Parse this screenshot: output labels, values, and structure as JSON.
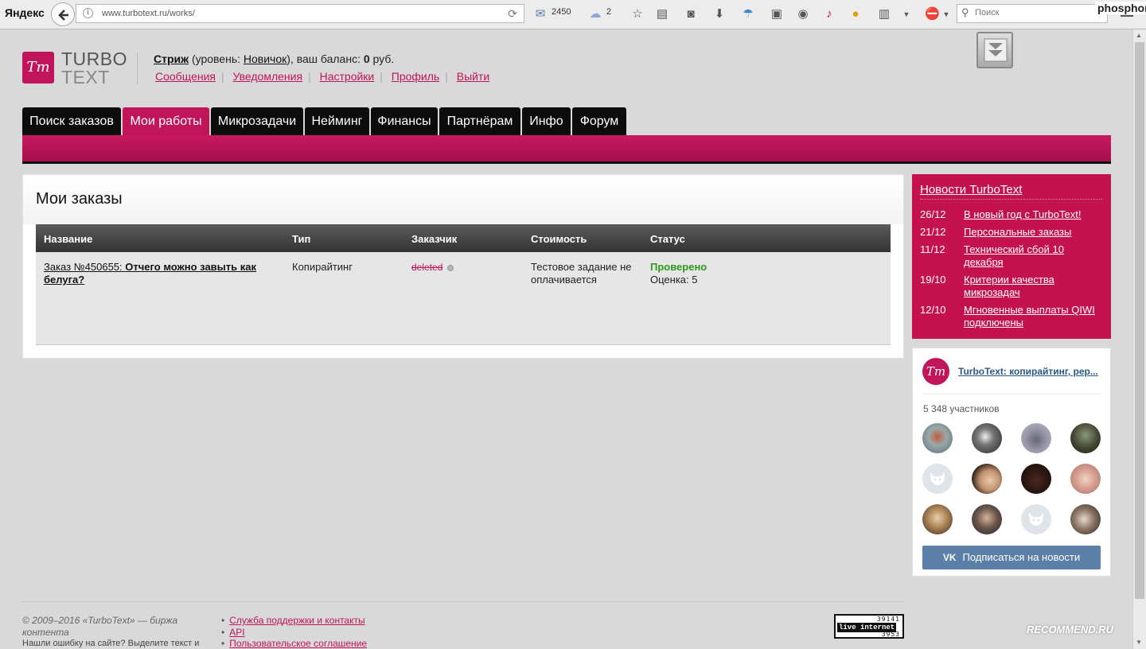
{
  "browser": {
    "brand": "Яндекс",
    "url": "www.turbotext.ru/works/",
    "mail_count": "2450",
    "cloud_count": "2",
    "search_placeholder": "Поиск",
    "overlay_user": "phosphor"
  },
  "site": {
    "logo_line1": "TURBO",
    "logo_line2": "TEXT",
    "logo_mark": "Тт"
  },
  "user": {
    "name": "Стриж",
    "level_prefix": " (уровень: ",
    "level": "Новичок",
    "balance_prefix": "), ваш баланс: ",
    "balance": "0",
    "balance_suffix": " руб.",
    "links": [
      "Сообщения",
      "Уведомления",
      "Настройки",
      "Профиль",
      "Выйти"
    ]
  },
  "nav": {
    "tabs": [
      "Поиск заказов",
      "Мои работы",
      "Микрозадачи",
      "Нейминг",
      "Финансы",
      "Партнёрам",
      "Инфо",
      "Форум"
    ],
    "active_index": 1
  },
  "orders": {
    "title": "Мои заказы",
    "columns": [
      "Название",
      "Тип",
      "Заказчик",
      "Стоимость",
      "Статус"
    ],
    "rows": [
      {
        "order_prefix": "Заказ №450655: ",
        "order_title": "Отчего можно завыть как белуга?",
        "type": "Копирайтинг",
        "customer": "deleted",
        "cost": "Тестовое задание не оплачивается",
        "status": "Проверено",
        "rating": "Оценка: 5"
      }
    ]
  },
  "news": {
    "title": "Новости TurboText",
    "items": [
      {
        "date": "26/12",
        "text": "В новый год с TurboText!"
      },
      {
        "date": "21/12",
        "text": "Персональные заказы"
      },
      {
        "date": "11/12",
        "text": "Технический сбой 10 декабря"
      },
      {
        "date": "19/10",
        "text": "Критерии качества микрозадач"
      },
      {
        "date": "12/10",
        "text": "Мгновенные выплаты QIWI подключены"
      }
    ]
  },
  "vk": {
    "group_name": "TurboText: копирайтинг, реp...",
    "members": "5 348 участников",
    "subscribe": "Подписаться на новости",
    "vk_mark": "VK"
  },
  "footer": {
    "copyright": "© 2009–2016 «TurboText» — биржа контента",
    "hint": "Нашли ошибку на сайте? Выделите текст и",
    "links": [
      "Служба поддержки и контакты",
      "API",
      "Пользовательское соглашение"
    ],
    "counter_top": "39141",
    "counter_brand": "live internet",
    "counter_bottom": "3953"
  },
  "watermark": "RECOMMEND.RU",
  "colors": {
    "brand": "#c0155a",
    "nav_dark": "#0c0c0c",
    "status_ok": "#2c9a1e",
    "vk_button": "#5b7fa6"
  }
}
